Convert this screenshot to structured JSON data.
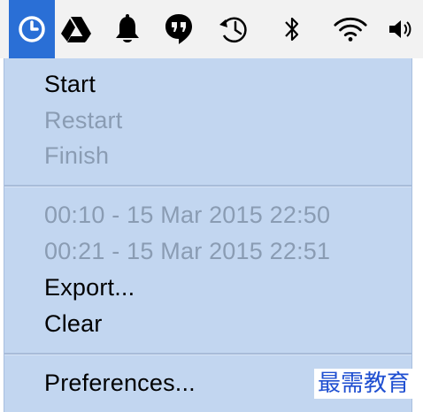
{
  "menubar": {
    "icons": [
      {
        "name": "clock-icon",
        "active": true
      },
      {
        "name": "google-drive-icon",
        "active": false
      },
      {
        "name": "bell-icon",
        "active": false
      },
      {
        "name": "hangouts-icon",
        "active": false
      },
      {
        "name": "time-machine-icon",
        "active": false
      },
      {
        "name": "bluetooth-icon",
        "active": false
      },
      {
        "name": "wifi-icon",
        "active": false
      },
      {
        "name": "volume-icon",
        "active": false
      }
    ],
    "active_color": "#2a6fd6"
  },
  "menu": {
    "background_color": "#c2d6f0",
    "disabled_color": "#8a9cb3",
    "start": "Start",
    "restart": "Restart",
    "finish": "Finish",
    "history": [
      "00:10 - 15 Mar 2015 22:50",
      "00:21 - 15 Mar 2015 22:51"
    ],
    "export": "Export...",
    "clear": "Clear",
    "preferences": "Preferences..."
  },
  "watermark": {
    "text": "最需教育",
    "color": "#1f4fd1"
  }
}
